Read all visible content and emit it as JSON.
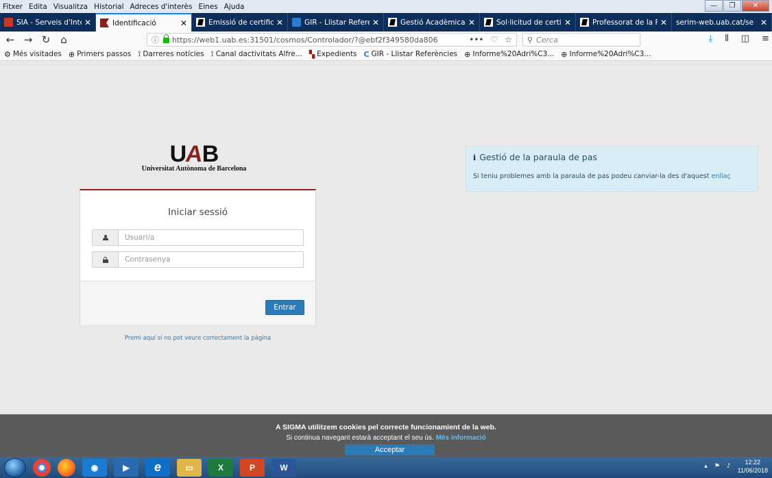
{
  "menubar": {
    "items": [
      "Fitxer",
      "Edita",
      "Visualitza",
      "Historial",
      "Adreces d'interès",
      "Eines",
      "Ajuda"
    ]
  },
  "tabs": [
    {
      "title": "SIA - Serveis d'Inte",
      "favicon": "sia-icon",
      "active": false
    },
    {
      "title": "Identificació",
      "favicon": "uab-icon",
      "active": true
    },
    {
      "title": "Emissió de certific",
      "favicon": "uab-icon",
      "active": false
    },
    {
      "title": "GIR - Llistar Refere",
      "favicon": "gir-icon",
      "active": false
    },
    {
      "title": "Gestió Acadèmica",
      "favicon": "uab-icon",
      "active": false
    },
    {
      "title": "Sol·licitud de certi",
      "favicon": "uab-icon",
      "active": false
    },
    {
      "title": "Professorat de la F",
      "favicon": "uab-icon",
      "active": false
    },
    {
      "title": "serim-web.uab.cat/se",
      "favicon": "",
      "active": false
    }
  ],
  "navbar": {
    "url": "https://web1.uab.es:31501/cosmos/Controlador/?@ebf2f349580da806",
    "search_placeholder": "Cerca"
  },
  "bookmarks": [
    {
      "label": "Més visitades",
      "icon": "gear-icon"
    },
    {
      "label": "Primers passos",
      "icon": "globe-icon"
    },
    {
      "label": "Darreres notícies",
      "icon": "rss-icon"
    },
    {
      "label": "Canal dactivitats Alfre...",
      "icon": "rss-icon"
    },
    {
      "label": "Expedients",
      "icon": "uab-icon"
    },
    {
      "label": "GIR - Llistar Referències",
      "icon": "gir-icon"
    },
    {
      "label": "Informe%20Adri%C3...",
      "icon": "globe-icon"
    },
    {
      "label": "Informe%20Adri%C3...",
      "icon": "globe-icon"
    }
  ],
  "logo": {
    "mark_u": "U",
    "mark_a": "A",
    "mark_b": "B",
    "subtitle": "Universitat Autònoma de Barcelona"
  },
  "login": {
    "title": "Iniciar sessió",
    "username_placeholder": "Usuari/a",
    "username_value": "",
    "password_placeholder": "Contrasenya",
    "password_value": "",
    "submit_label": "Entrar",
    "help_link": "Premi aquí si no pot veure correctament la pàgina"
  },
  "info": {
    "title": "Gestió de la paraula de pas",
    "text": "Si teniu problemes amb la paraula de pas podeu canviar-la des d'aquest",
    "link": "enllaç"
  },
  "cookie": {
    "line1": "A SIGMA utilitzem cookies pel correcte funcionamient de la web.",
    "line2": "Si continua navegant estarà acceptant el seu ús.",
    "more_link": "Més informació",
    "accept_label": "Acceptar"
  },
  "taskbar": {
    "time": "12:22",
    "date": "11/06/2018"
  },
  "colors": {
    "uab_red": "#8e1f1f",
    "primary_blue": "#2d7bb6",
    "info_bg": "#d9edf7",
    "tabbar_bg": "#0b2f5a"
  }
}
